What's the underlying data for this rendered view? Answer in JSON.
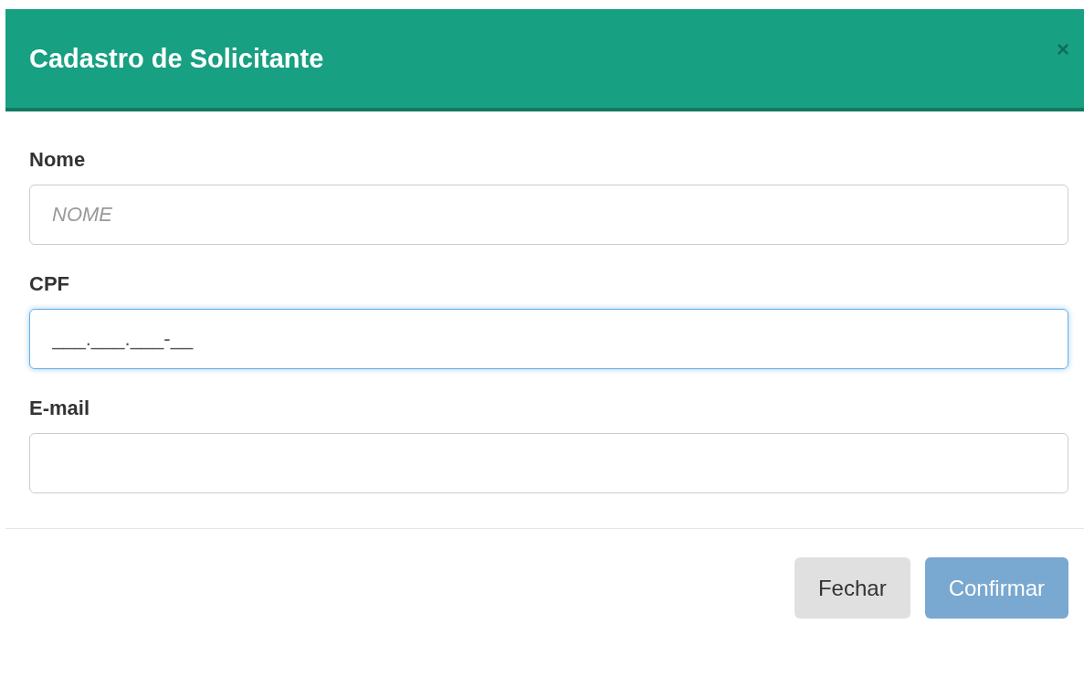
{
  "dialog": {
    "title": "Cadastro de Solicitante",
    "close": "×"
  },
  "fields": [
    {
      "label": "Nome",
      "placeholder": "NOME",
      "focused": false
    },
    {
      "label": "CPF",
      "value": "___.___.___-__",
      "focused": true
    },
    {
      "label": "E-mail",
      "focused": false
    }
  ],
  "buttons": [
    {
      "label": "Fechar",
      "kind": "secondary",
      "disabled": false
    },
    {
      "label": "Confirmar",
      "kind": "primary",
      "disabled": true
    }
  ]
}
